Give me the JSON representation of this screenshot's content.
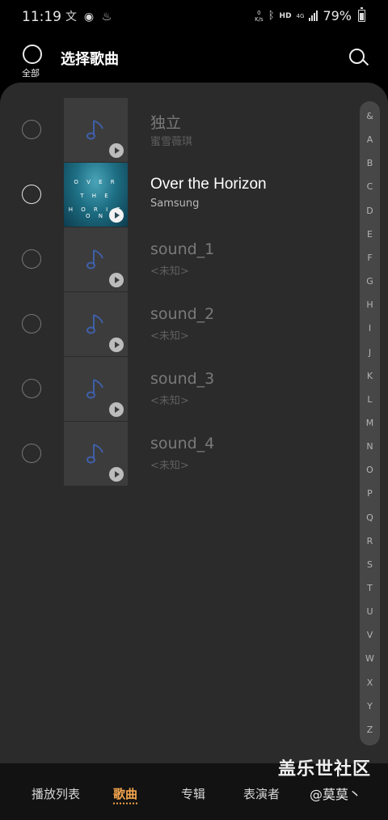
{
  "status_bar": {
    "time": "11:19",
    "left_icons": [
      "translate-icon",
      "wechat-icon",
      "notification-icon"
    ],
    "net_speed_value": "0",
    "net_speed_unit": "K/s",
    "hd_label": "HD",
    "network_label": "4G",
    "battery_percent": "79%"
  },
  "header": {
    "select_all_label": "全部",
    "title": "选择歌曲"
  },
  "songs": [
    {
      "title": "独立",
      "artist": "蜜雪薇琪",
      "art": "default-note-icon",
      "active": false
    },
    {
      "title": "Over the Horizon",
      "artist": "Samsung",
      "art": "album-art-over-the-horizon",
      "art_lines": [
        "O V E R",
        "T H E",
        "H O R I Z O N"
      ],
      "active": true
    },
    {
      "title": "sound_1",
      "artist": "<未知>",
      "art": "default-note-icon",
      "active": false
    },
    {
      "title": "sound_2",
      "artist": "<未知>",
      "art": "default-note-icon",
      "active": false
    },
    {
      "title": "sound_3",
      "artist": "<未知>",
      "art": "default-note-icon",
      "active": false
    },
    {
      "title": "sound_4",
      "artist": "<未知>",
      "art": "default-note-icon",
      "active": false
    }
  ],
  "index_letters": [
    "&",
    "A",
    "B",
    "C",
    "D",
    "E",
    "F",
    "G",
    "H",
    "I",
    "J",
    "K",
    "L",
    "M",
    "N",
    "O",
    "P",
    "Q",
    "R",
    "S",
    "T",
    "U",
    "V",
    "W",
    "X",
    "Y",
    "Z"
  ],
  "bottom_nav": {
    "tabs": [
      {
        "label": "播放列表",
        "active": false
      },
      {
        "label": "歌曲",
        "active": true
      },
      {
        "label": "专辑",
        "active": false
      },
      {
        "label": "表演者",
        "active": false
      }
    ],
    "accent_color": "#f4a64d"
  },
  "watermark": {
    "site": "盖乐世社区",
    "user": "@莫莫丶"
  }
}
